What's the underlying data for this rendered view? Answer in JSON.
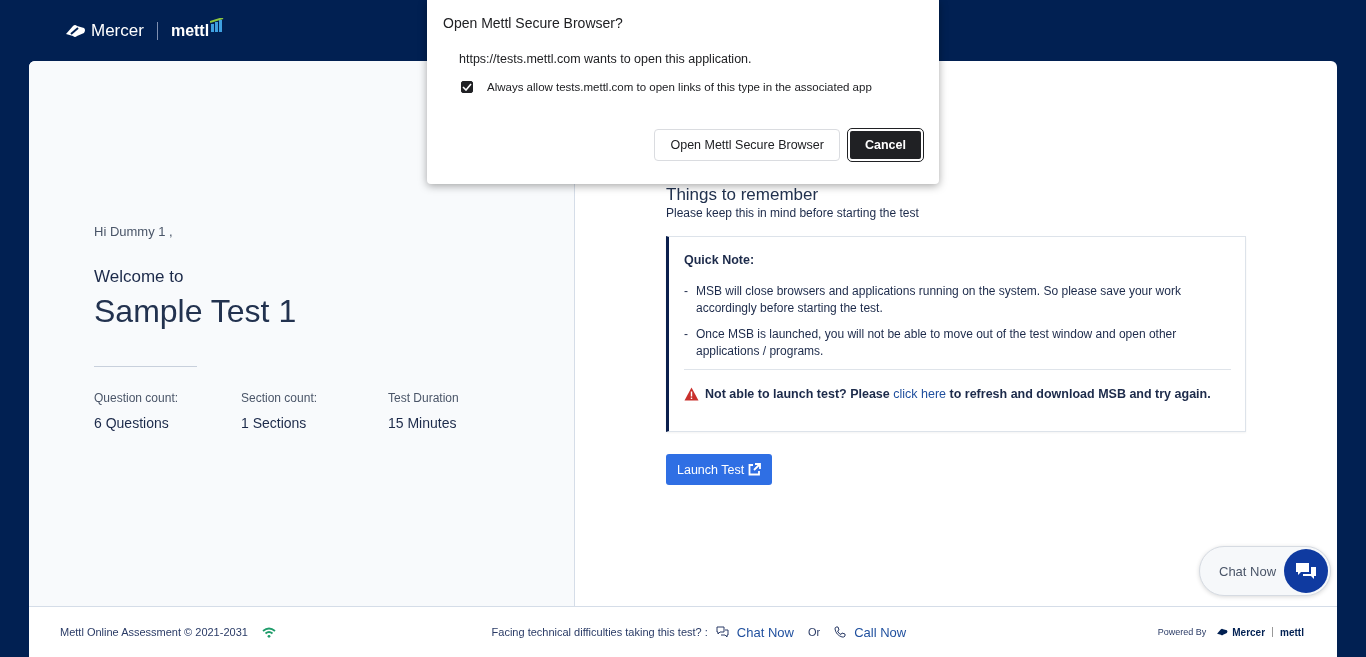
{
  "header": {
    "brand": "Mercer",
    "product": "mettl"
  },
  "welcome": {
    "greeting": "Hi Dummy 1 ,",
    "intro": "Welcome to",
    "test_name": "Sample Test 1",
    "stats": [
      {
        "label": "Question count:",
        "value": "6 Questions"
      },
      {
        "label": "Section count:",
        "value": "1 Sections"
      },
      {
        "label": "Test Duration",
        "value": "15  Minutes"
      }
    ]
  },
  "instructions": {
    "title": "Things to remember",
    "subtitle": "Please keep this in mind before starting the test",
    "note_title": "Quick Note:",
    "points": [
      {
        "bullet": "-",
        "text": "MSB will close browsers and applications running on the system. So please save your work accordingly before starting the test."
      },
      {
        "bullet": "-",
        "text": "Once MSB is launched, you will not be able to move out of the test window and open other applications / programs."
      }
    ],
    "warning_before": "Not able to launch test? Please",
    "warning_link": "click here",
    "warning_after": "to refresh and download MSB and try again.",
    "launch_button": "Launch Test"
  },
  "chat_widget": {
    "label": "Chat Now"
  },
  "footer": {
    "copyright": "Mettl Online Assessment © 2021-2031",
    "help_text": "Facing technical difficulties taking this test? :",
    "chat_link": "Chat Now",
    "separator": "Or",
    "call_link": "Call Now",
    "powered_by": "Powered By",
    "brand": "Mercer",
    "product": "mettl"
  },
  "dialog": {
    "title": "Open Mettl Secure Browser?",
    "message": "https://tests.mettl.com wants to open this application.",
    "checkbox": {
      "label": "Always allow tests.mettl.com to open links of this type in the associated app",
      "checked": true
    },
    "buttons": [
      "Open Mettl Secure Browser",
      "Cancel"
    ]
  }
}
